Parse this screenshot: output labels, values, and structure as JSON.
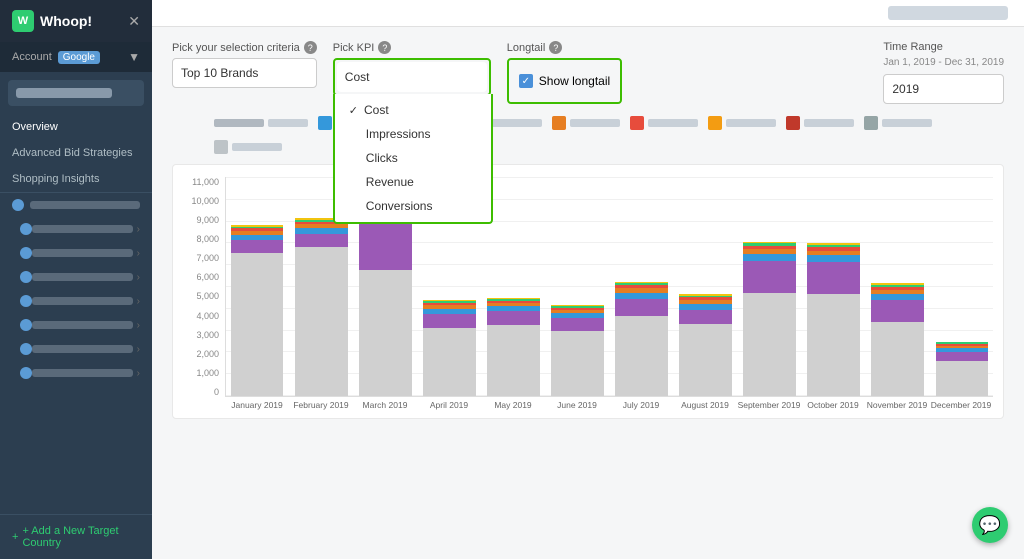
{
  "app": {
    "title": "Whoop!",
    "logo_letter": "W"
  },
  "sidebar": {
    "account_label": "Account",
    "account_name": "Google",
    "nav_items": [
      {
        "label": "Overview",
        "active": true
      },
      {
        "label": "Advanced Bid Strategies",
        "active": false
      },
      {
        "label": "Shopping Insights",
        "active": false
      }
    ],
    "add_country_label": "+ Add a New Target Country"
  },
  "controls": {
    "selection_label": "Pick your selection criteria",
    "selection_value": "Top 10 Brands",
    "kpi_label": "Pick KPI",
    "kpi_value": "Cost",
    "kpi_options": [
      "Cost",
      "Impressions",
      "Clicks",
      "Revenue",
      "Conversions"
    ],
    "longtail_label": "Longtail",
    "longtail_show": "Show longtail",
    "time_range_label": "Time Range",
    "time_range_dates": "Jan 1, 2019 - Dec 31, 2019",
    "time_range_value": "2019"
  },
  "chart": {
    "y_labels": [
      "11,000",
      "10,000",
      "9,000",
      "8,000",
      "7,000",
      "6,000",
      "5,000",
      "4,000",
      "3,000",
      "2,000",
      "1,000",
      "0"
    ],
    "x_labels": [
      "January 2019",
      "February 2019",
      "March 2019",
      "April 2019",
      "May 2019",
      "June 2019",
      "July 2019",
      "August 2019",
      "September 2019",
      "October 2019",
      "November 2019",
      "December 2019"
    ],
    "bars": [
      {
        "total": 9400,
        "purple": 700,
        "blue": 300,
        "orange": 200,
        "red": 150,
        "green": 100,
        "yellow": 80
      },
      {
        "total": 9800,
        "purple": 750,
        "blue": 310,
        "orange": 210,
        "red": 160,
        "green": 110,
        "yellow": 90
      },
      {
        "total": 10800,
        "purple": 2600,
        "blue": 400,
        "orange": 300,
        "red": 250,
        "green": 180,
        "yellow": 130
      },
      {
        "total": 5300,
        "purple": 800,
        "blue": 280,
        "orange": 190,
        "red": 140,
        "green": 95,
        "yellow": 70
      },
      {
        "total": 5400,
        "purple": 750,
        "blue": 270,
        "orange": 180,
        "red": 135,
        "green": 90,
        "yellow": 65
      },
      {
        "total": 5000,
        "purple": 700,
        "blue": 260,
        "orange": 175,
        "red": 130,
        "green": 85,
        "yellow": 60
      },
      {
        "total": 6300,
        "purple": 900,
        "blue": 350,
        "orange": 240,
        "red": 180,
        "green": 120,
        "yellow": 85
      },
      {
        "total": 5600,
        "purple": 800,
        "blue": 310,
        "orange": 210,
        "red": 155,
        "green": 100,
        "yellow": 72
      },
      {
        "total": 8500,
        "purple": 1800,
        "blue": 380,
        "orange": 260,
        "red": 195,
        "green": 130,
        "yellow": 95
      },
      {
        "total": 8400,
        "purple": 1750,
        "blue": 375,
        "orange": 255,
        "red": 192,
        "green": 128,
        "yellow": 93
      },
      {
        "total": 6200,
        "purple": 1200,
        "blue": 340,
        "orange": 230,
        "red": 170,
        "green": 115,
        "yellow": 82
      },
      {
        "total": 3000,
        "purple": 500,
        "blue": 200,
        "orange": 140,
        "red": 100,
        "green": 70,
        "yellow": 50
      }
    ],
    "max_value": 11000,
    "colors": {
      "gray": "#d0d0d0",
      "purple": "#9b59b6",
      "blue": "#3498db",
      "orange": "#e67e22",
      "red": "#e74c3c",
      "green": "#2ecc71",
      "yellow": "#f1c40f"
    }
  },
  "legend": {
    "items": [
      {
        "color": "#b0b8c0",
        "label": ""
      },
      {
        "color": "#3498db",
        "label": ""
      },
      {
        "color": "#2ecc71",
        "label": ""
      },
      {
        "color": "#9b59b6",
        "label": ""
      },
      {
        "color": "#e67e22",
        "label": ""
      },
      {
        "color": "#e74c3c",
        "label": ""
      },
      {
        "color": "#f1c40f",
        "label": ""
      },
      {
        "color": "#c0392b",
        "label": ""
      },
      {
        "color": "#1abc9c",
        "label": ""
      },
      {
        "color": "#34495e",
        "label": ""
      }
    ]
  }
}
